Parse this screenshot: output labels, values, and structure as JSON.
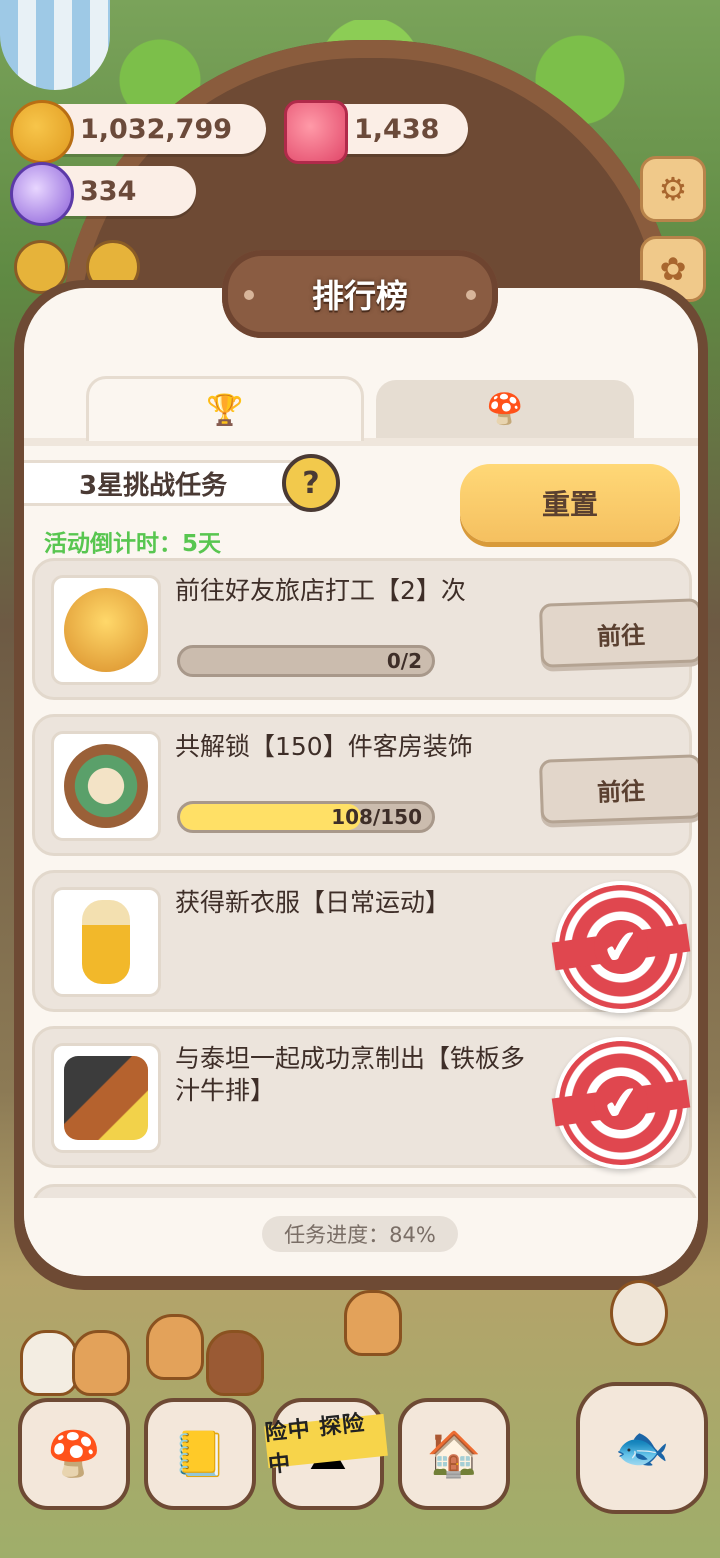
{
  "currencies": {
    "cookies": "1,032,799",
    "candy": "1,438",
    "gems": "334"
  },
  "panel": {
    "title": "排行榜",
    "tabs": [
      {
        "icon": "trophy-icon",
        "glyph": "🏆"
      },
      {
        "icon": "mushroom-icon",
        "glyph": "🍄"
      }
    ],
    "challenge_label": "3星挑战任务",
    "help_glyph": "?",
    "reset_label": "重置",
    "countdown": "活动倒计时：5天",
    "tasks": [
      {
        "text": "前往好友旅店打工【2】次",
        "progress_text": "0/2",
        "progress": 0.0,
        "button": "前往",
        "completed": false
      },
      {
        "text": "共解锁【150】件客房装饰",
        "progress_text": "108/150",
        "progress": 0.72,
        "button": "前往",
        "completed": false
      },
      {
        "text": "获得新衣服【日常运动】",
        "completed": true
      },
      {
        "text": "与泰坦一起成功烹制出【铁板多汁牛排】",
        "completed": true
      }
    ],
    "overall_progress": "任务进度：84%"
  },
  "bottom_nav": {
    "adventure_tape": "险中 探险中"
  },
  "colors": {
    "panel_border": "#6e4a34",
    "panel_bg": "#fbf6f0",
    "accent_yellow": "#f5c060",
    "countdown_green": "#58c650",
    "stamp_red": "#e0474f"
  }
}
